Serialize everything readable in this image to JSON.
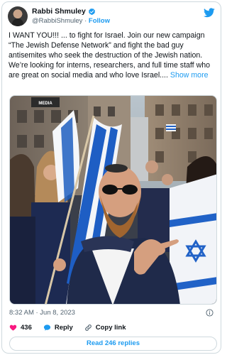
{
  "author": {
    "display_name": "Rabbi Shmuley",
    "handle": "@RabbiShmuley",
    "separator": " · ",
    "follow_label": "Follow"
  },
  "tweet": {
    "text": "I WANT YOU!!! ... to fight for Israel. Join our new campaign “The Jewish Defense Network” and fight the bad guy antisemites who seek the destruction of the Jewish nation. We’re looking for interns, researchers, and full time staff who are great on social media and who love Israel....",
    "show_more_label": "Show more",
    "timestamp": "8:32 AM · Jun 8, 2023"
  },
  "media": {
    "banner_text": "MEDIA"
  },
  "actions": {
    "like_count": "436",
    "reply_label": "Reply",
    "copy_link_label": "Copy link"
  },
  "footer": {
    "read_replies_label": "Read 246 replies"
  },
  "colors": {
    "accent": "#1d9bf0",
    "like": "#f91880",
    "text": "#0f1419",
    "muted": "#536471",
    "border": "#cfd9de"
  },
  "icons": {
    "verified": "verified-badge-icon",
    "brand": "twitter-bird-icon",
    "info": "info-icon",
    "like": "heart-icon",
    "reply": "speech-bubble-icon",
    "copy": "link-icon"
  }
}
